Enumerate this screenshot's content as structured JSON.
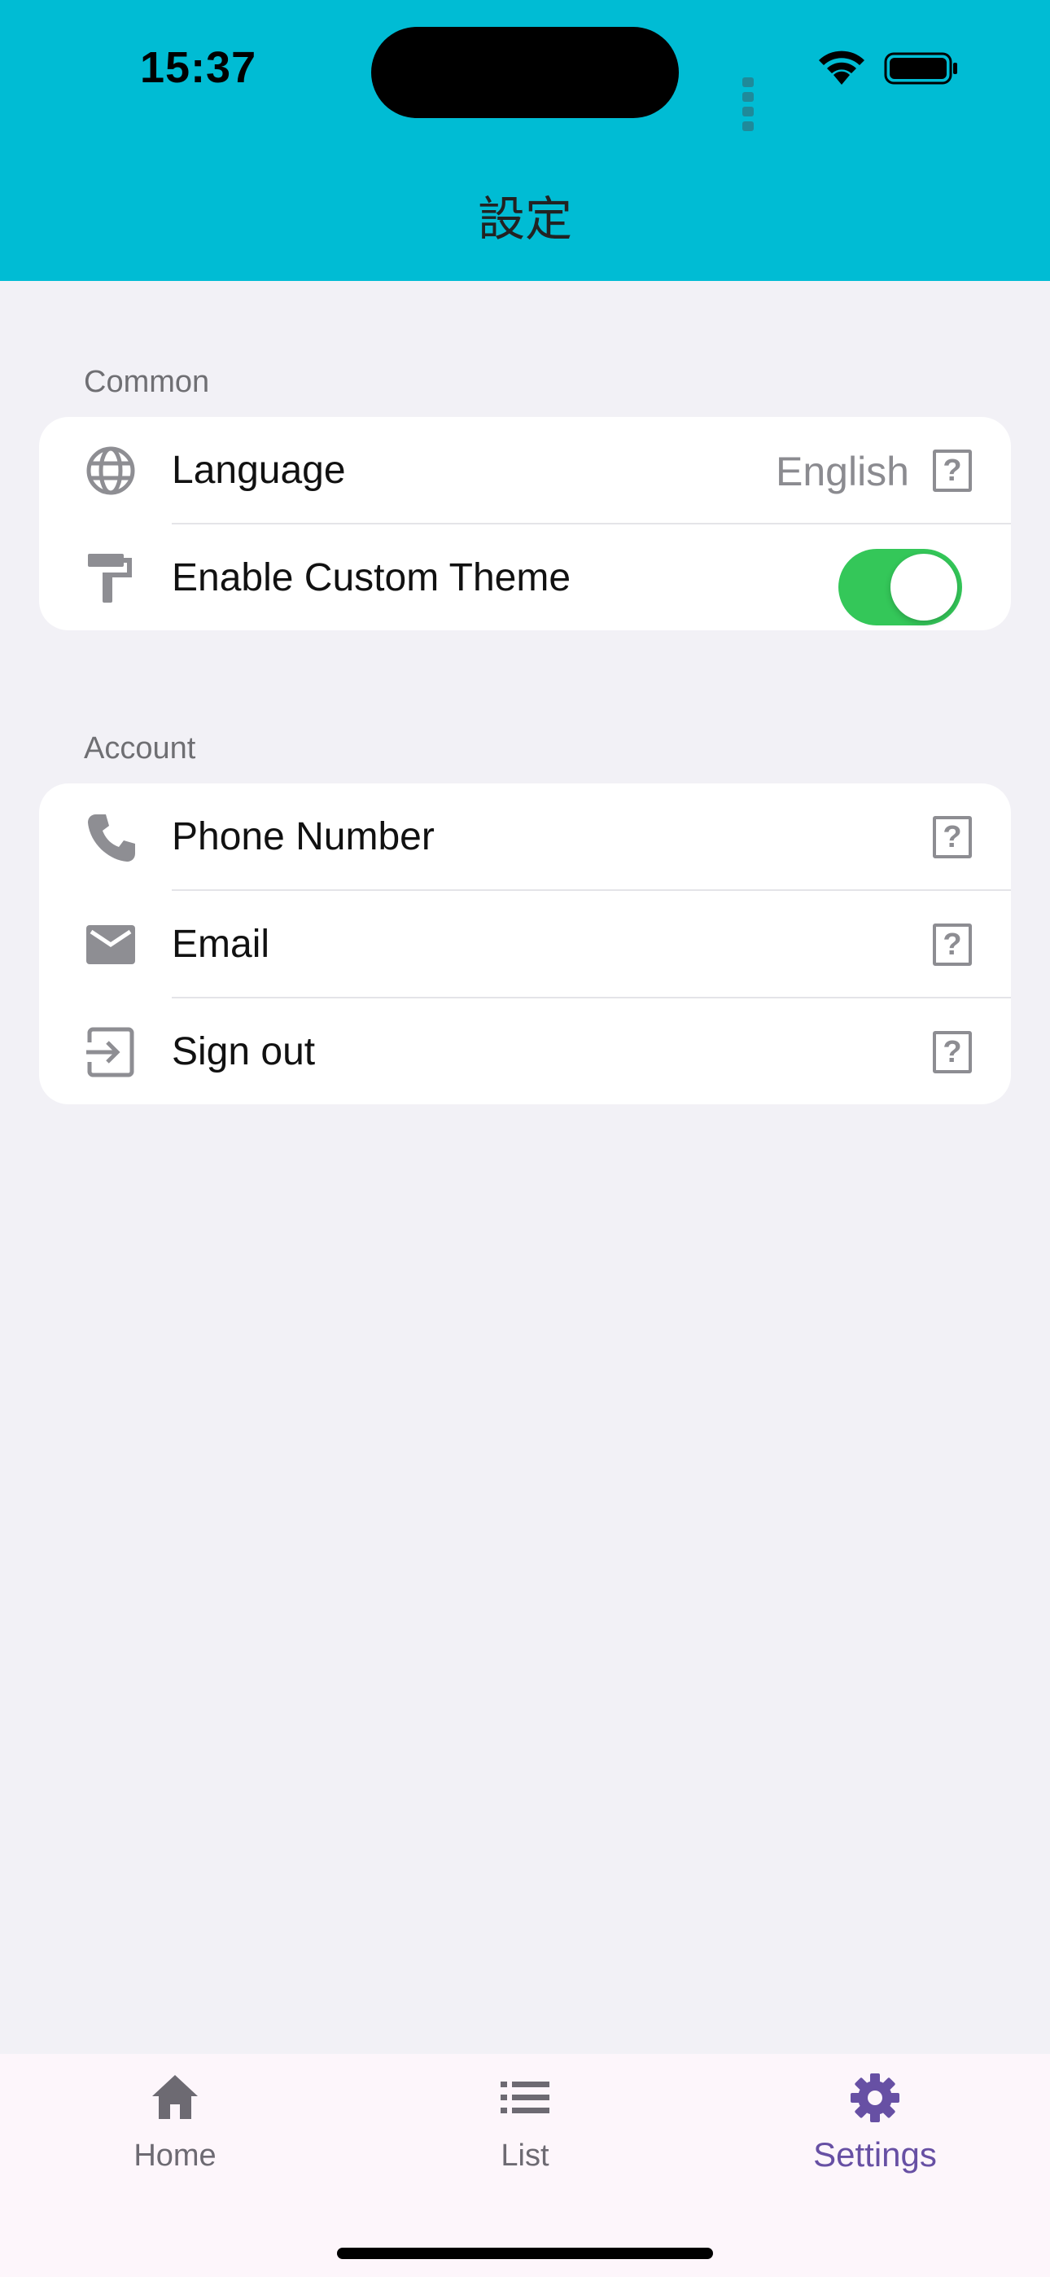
{
  "status_bar": {
    "time": "15:37"
  },
  "header": {
    "title": "設定"
  },
  "sections": {
    "common": {
      "label": "Common",
      "language": {
        "label": "Language",
        "value": "English",
        "icon": "globe-icon",
        "trailing_icon": "help-box-icon"
      },
      "theme": {
        "label": "Enable Custom Theme",
        "icon": "paint-roller-icon",
        "toggle_on": true
      }
    },
    "account": {
      "label": "Account",
      "phone": {
        "label": "Phone Number",
        "icon": "phone-icon",
        "trailing_icon": "help-box-icon"
      },
      "email": {
        "label": "Email",
        "icon": "mail-icon",
        "trailing_icon": "help-box-icon"
      },
      "signout": {
        "label": "Sign out",
        "icon": "sign-out-icon",
        "trailing_icon": "help-box-icon"
      }
    }
  },
  "tabs": [
    {
      "label": "Home",
      "icon": "home-icon",
      "active": false
    },
    {
      "label": "List",
      "icon": "list-icon",
      "active": false
    },
    {
      "label": "Settings",
      "icon": "gear-icon",
      "active": true
    }
  ],
  "colors": {
    "header": "#00bcd4",
    "background": "#f2f1f6",
    "toggle_on": "#34c759",
    "tab_active": "#6750a4",
    "icon_gray": "#8e8e93"
  }
}
